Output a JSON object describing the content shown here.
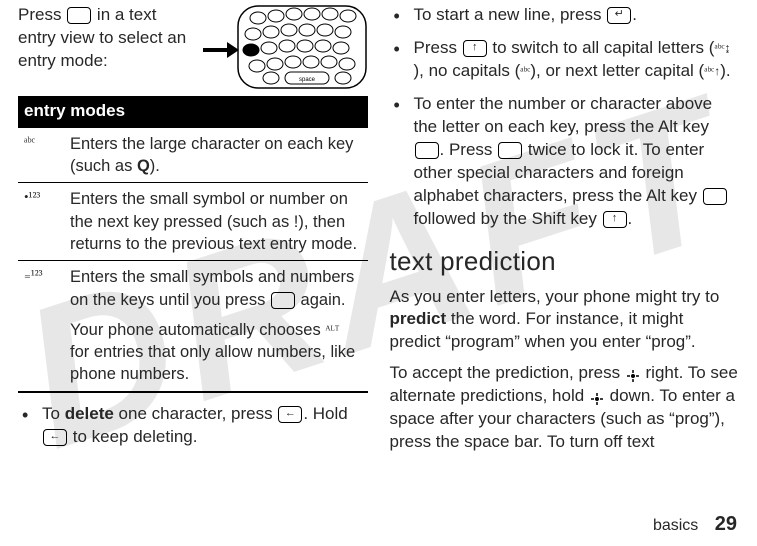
{
  "left": {
    "intro_pre": "Press ",
    "intro_post": " in a text entry view to select an entry mode:",
    "table_header": "entry modes",
    "rows": [
      {
        "sym": "ᵃᵇᶜ",
        "desc_pre": "Enters the large character on each key (such as ",
        "desc_bold": "Q",
        "desc_post": ")."
      },
      {
        "sym": "•¹²³",
        "desc": "Enters the small symbol or number on the next key pressed (such as !), then returns to the previous text entry mode."
      },
      {
        "sym": "₌¹²³",
        "desc1_pre": "Enters the small symbols and numbers on the keys until you press ",
        "desc1_post": " again.",
        "desc2_pre": "Your phone automatically chooses ",
        "desc2_sym": "ᴬᴸᵀ",
        "desc2_post": " for entries that only allow numbers, like phone numbers."
      }
    ],
    "bullet_delete_pre": "To ",
    "bullet_delete_bold": "delete",
    "bullet_delete_mid": " one character, press ",
    "bullet_delete_mid2": ". Hold ",
    "bullet_delete_post": " to keep deleting."
  },
  "right": {
    "b1_pre": "To start a new line, press ",
    "b1_post": ".",
    "b2_pre": "Press ",
    "b2_mid1": " to switch to all capital letters (",
    "b2_sym1": "ᵃᵇᶜ↨",
    "b2_mid2": "), no capitals (",
    "b2_sym2": "ᵃᵇᶜ",
    "b2_mid3": "), or next letter capital (",
    "b2_sym3": "ᵃᵇᶜ↑",
    "b2_post": ").",
    "b3_pre": "To enter the number or character above the letter on each key, press the Alt key ",
    "b3_mid1": ". Press ",
    "b3_mid2": " twice to lock it. To enter other special characters and foreign alphabet characters, press the Alt key ",
    "b3_mid3": " followed by the Shift key ",
    "b3_post": ".",
    "heading": "text prediction",
    "p1_pre": "As you enter letters, your phone might try to ",
    "p1_bold": "predict",
    "p1_post": " the word. For instance, it might predict “program” when you enter “prog”.",
    "p2_pre": "To accept the prediction, press ",
    "p2_mid1": " right. To see alternate predictions, hold ",
    "p2_post": " down. To enter a space after your characters (such as “prog”), press the space bar. To turn off text"
  },
  "footer": {
    "section": "basics",
    "page": "29"
  }
}
